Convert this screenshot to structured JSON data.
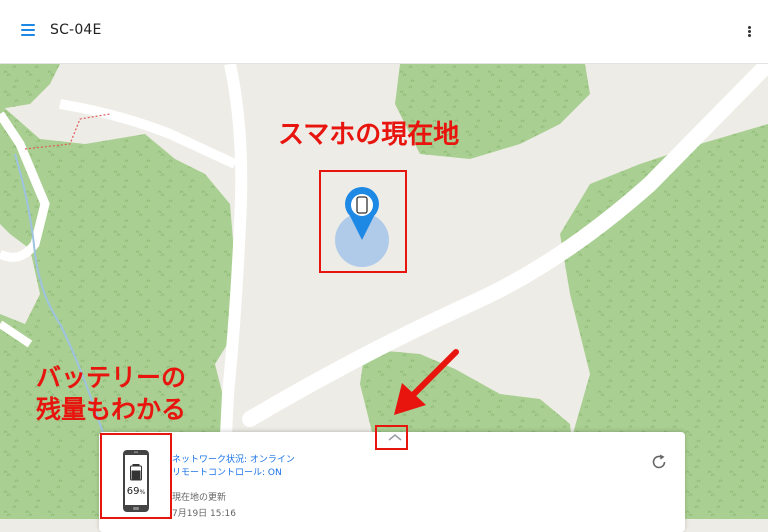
{
  "app": {
    "title": "SC-04E"
  },
  "annotations": {
    "location": "スマホの現在地",
    "battery_line1": "バッテリーの",
    "battery_line2": "残量もわかる"
  },
  "device_card": {
    "network_status": "ネットワーク状況: オンライン",
    "remote_control": "リモートコントロール: ON",
    "last_updated_label": "現在地の更新",
    "last_updated_time": "7月19日 15:16",
    "battery_value": "69",
    "battery_unit": "%",
    "battery_level": 0.69
  },
  "icons": [
    "menu-icon",
    "more-options-icon",
    "location-pin-icon",
    "phone-icon",
    "refresh-icon",
    "chevron-up-icon"
  ],
  "colors": {
    "accent": "#1e88e5",
    "annotation": "#e8150f",
    "forest": "#a9cf92",
    "map_bg": "#eeece6"
  }
}
